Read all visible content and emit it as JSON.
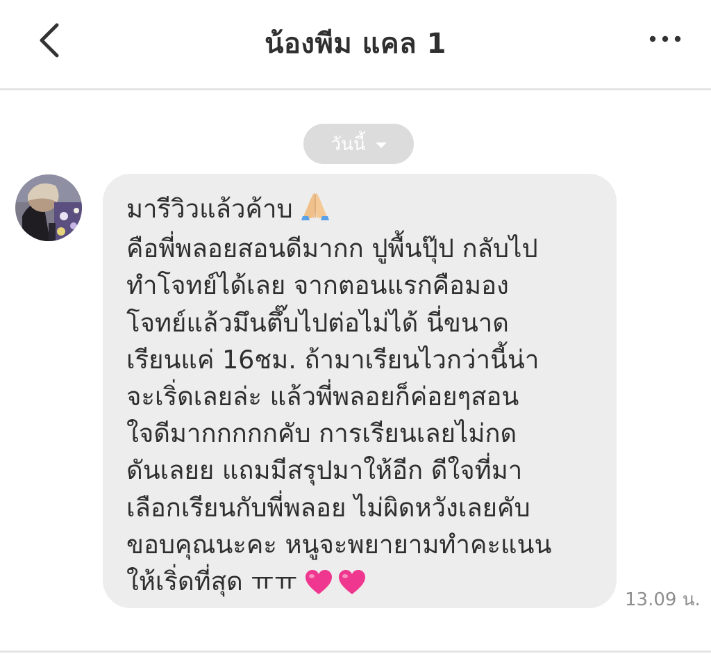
{
  "header": {
    "title": "น้องพีม แคล 1",
    "back_icon": "chevron-left-icon",
    "more_icon": "more-horizontal-icon"
  },
  "date_separator": {
    "label": "วันนี้",
    "icon": "caret-down-icon"
  },
  "message": {
    "sender_avatar": "avatar-photo",
    "lines": [
      "มารีวิวแล้วค้าบ",
      "คือพี่พลอยสอนดีมากก ปูพื้นปุ๊ป กลับไป",
      "ทำโจทย์ได้เลย จากตอนแรกคือมอง",
      "โจทย์แล้วมึนตึ๊บไปต่อไม่ได้ นี่ขนาด",
      "เรียนแค่ 16ชม. ถ้ามาเรียนไวกว่านี้น่า",
      "จะเริ่ดเลยล่ะ แล้วพี่พลอยก็ค่อยๆสอน",
      "ใจดีมากกกกกคับ การเรียนเลยไม่กด",
      "ดันเลยย แถมมีสรุปมาให้อีก ดีใจที่มา",
      "เลือกเรียนกับพี่พลอย ไม่ผิดหวังเลยคับ",
      "ขอบคุณนะคะ หนูจะพยายามทำคะแนน",
      "ให้เริ่ดที่สุด ㅠㅠ"
    ],
    "emojis": [
      "folded-hands-icon",
      "pink-heart-icon",
      "pink-heart-icon"
    ],
    "time": "13.09 น."
  },
  "colors": {
    "bubble": "#ededed",
    "pill": "#dcdcdc",
    "heart": "#f0378f",
    "hands": "#f1c08f"
  }
}
